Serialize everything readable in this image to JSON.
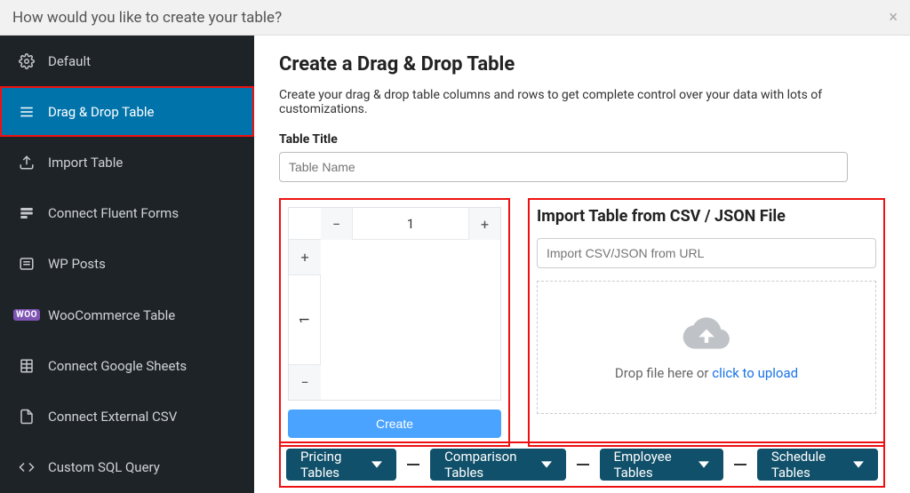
{
  "modal": {
    "title": "How would you like to create your table?"
  },
  "sidebar": {
    "items": [
      {
        "label": "Default"
      },
      {
        "label": "Drag & Drop Table"
      },
      {
        "label": "Import Table"
      },
      {
        "label": "Connect Fluent Forms"
      },
      {
        "label": "WP Posts"
      },
      {
        "label": "WooCommerce Table",
        "badge": "WOO"
      },
      {
        "label": "Connect Google Sheets"
      },
      {
        "label": "Connect External CSV"
      },
      {
        "label": "Custom SQL Query"
      }
    ]
  },
  "main": {
    "heading": "Create a Drag & Drop Table",
    "description": "Create your drag & drop table columns and rows to get complete control over your data with lots of customizations.",
    "title_label": "Table Title",
    "title_placeholder": "Table Name",
    "grid": {
      "cols": "1",
      "rows": "1",
      "create_label": "Create"
    },
    "import": {
      "heading": "Import Table from CSV / JSON File",
      "url_placeholder": "Import CSV/JSON from URL",
      "drop_text": "Drop file here or ",
      "drop_link": "click to upload"
    },
    "tabs": [
      {
        "label": "Pricing Tables"
      },
      {
        "label": "Comparison Tables"
      },
      {
        "label": "Employee Tables"
      },
      {
        "label": "Schedule Tables"
      }
    ]
  }
}
